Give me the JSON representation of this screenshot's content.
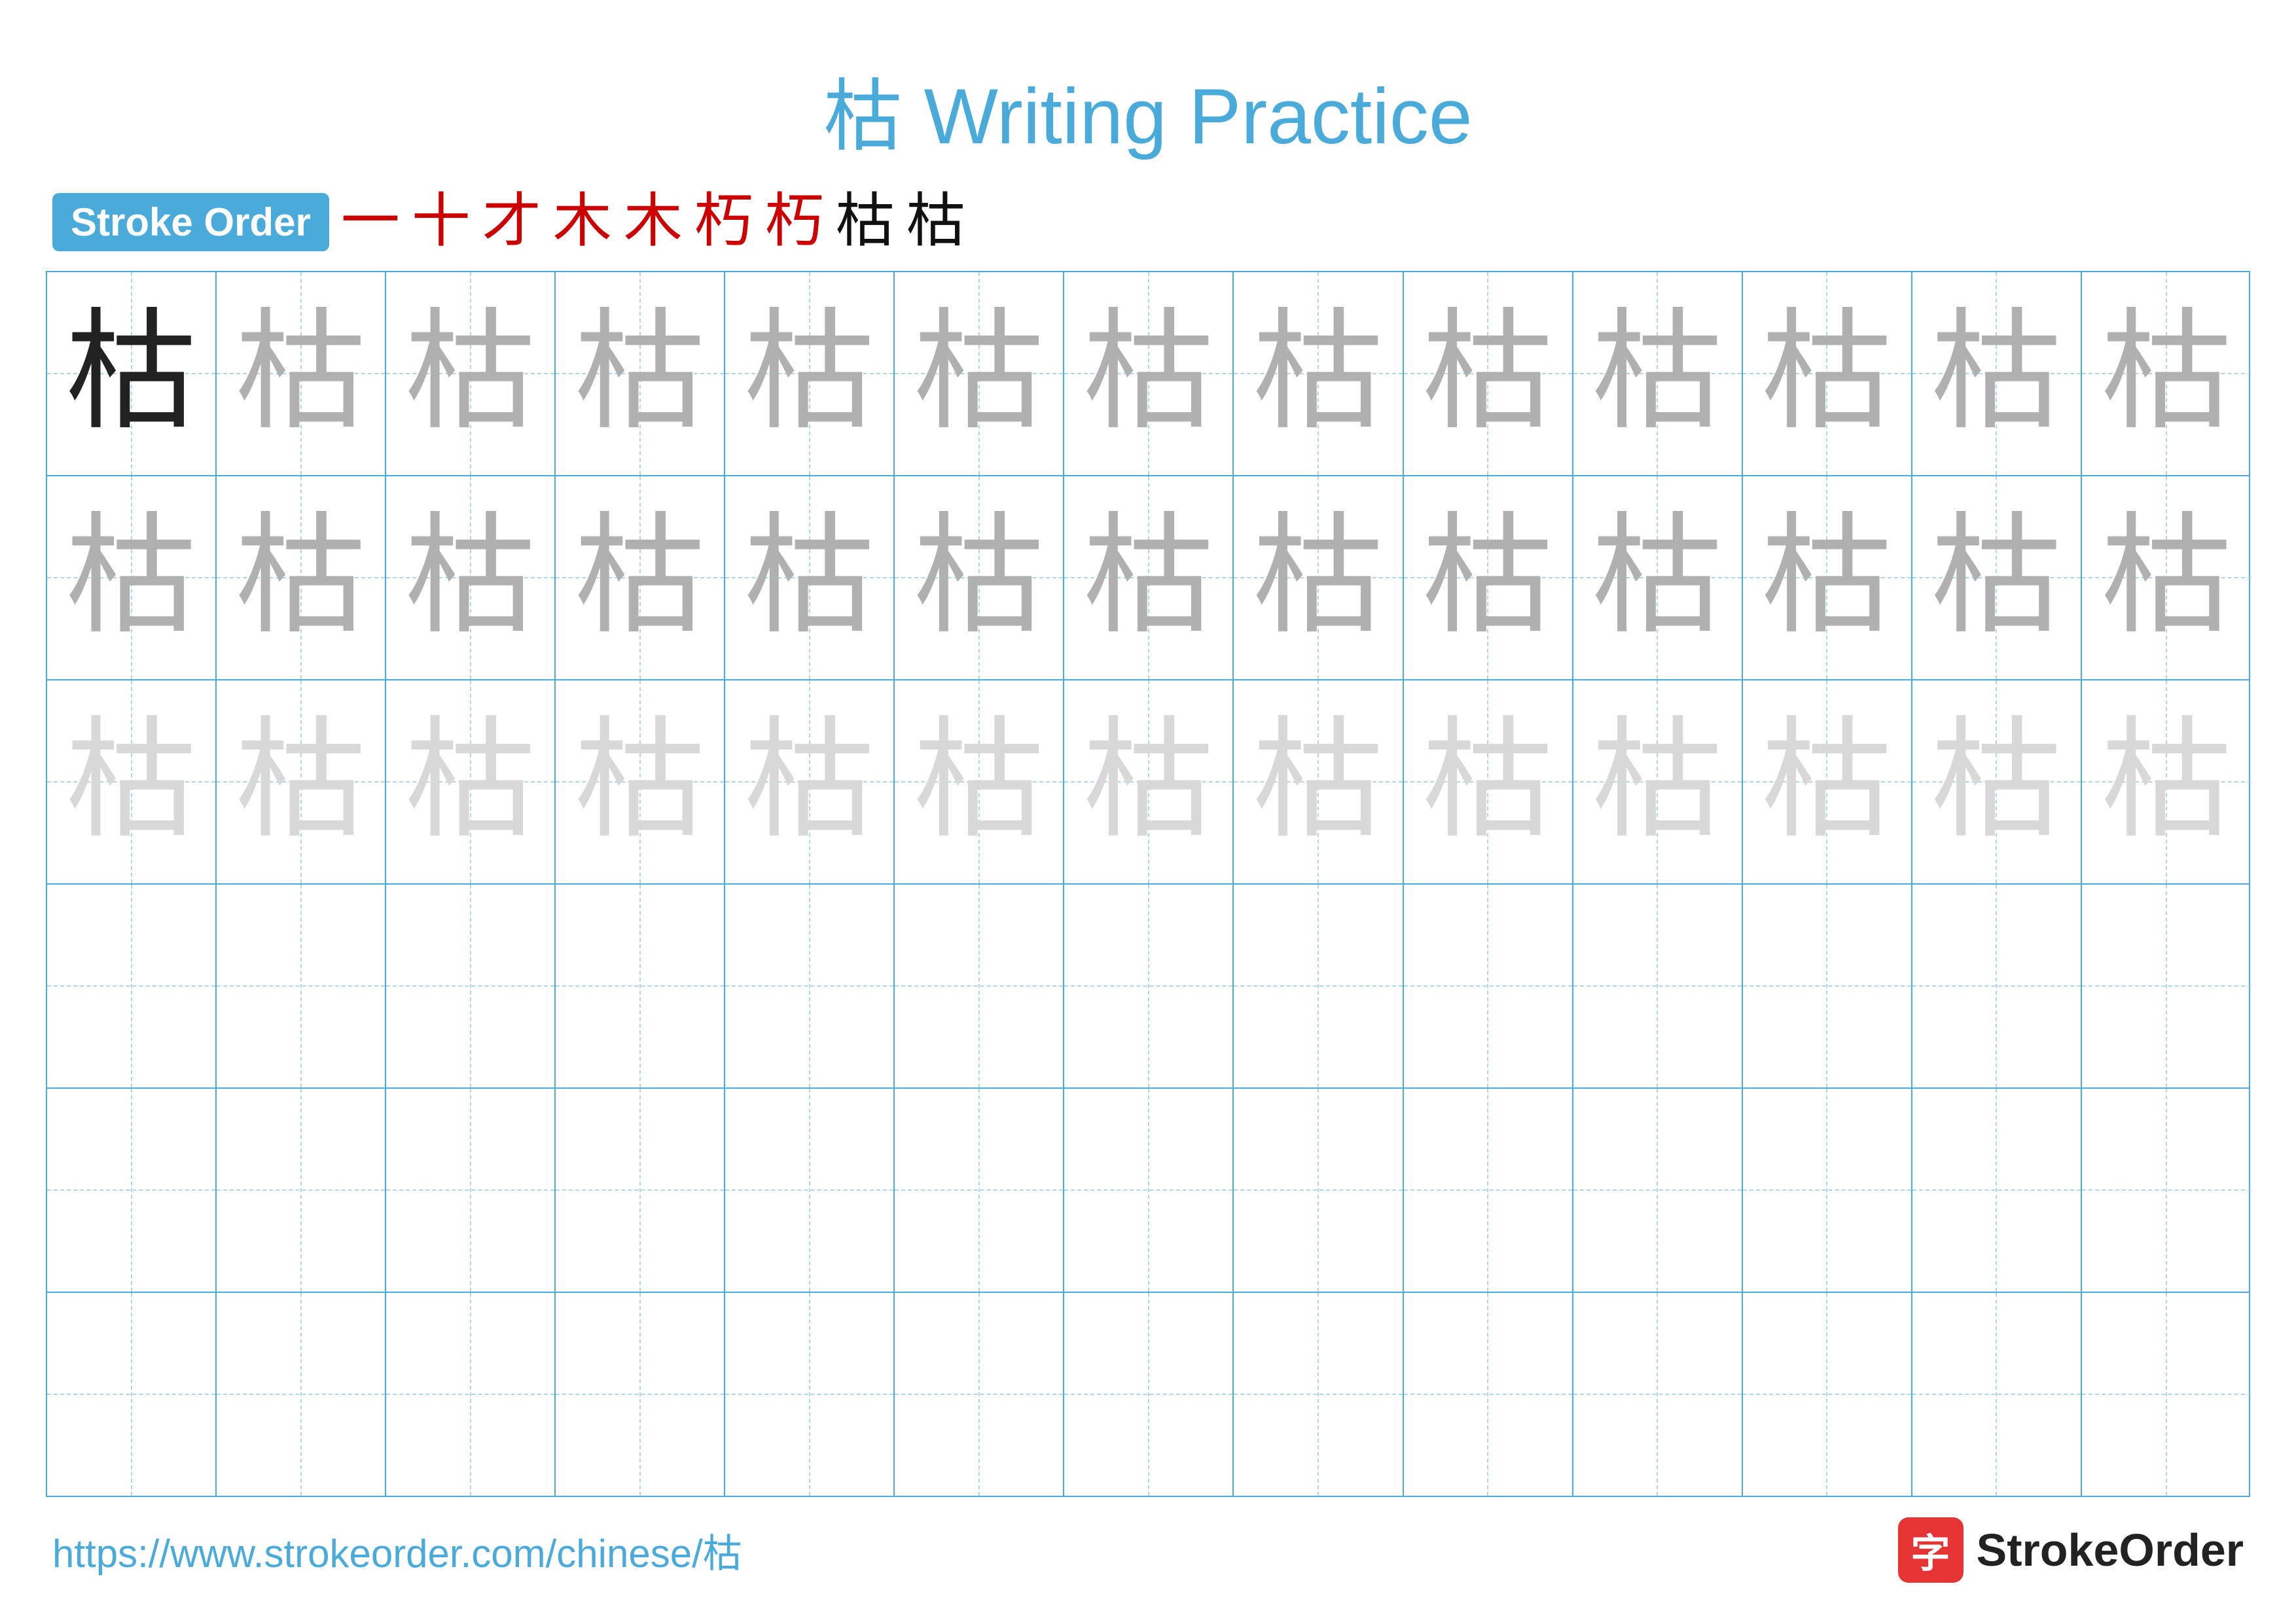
{
  "title": {
    "text": "枯 Writing Practice",
    "color": "#4AABDB"
  },
  "stroke_order": {
    "badge_label": "Stroke Order",
    "strokes": [
      "一",
      "十",
      "才",
      "木",
      "木",
      "朽",
      "朽",
      "枯",
      "枯"
    ]
  },
  "grid": {
    "rows": 6,
    "cols": 13,
    "char": "枯",
    "row_styles": [
      "solid_then_medium",
      "medium",
      "light",
      "empty",
      "empty",
      "empty"
    ]
  },
  "footer": {
    "url": "https://www.strokeorder.com/chinese/枯",
    "logo_char": "字",
    "logo_text": "StrokeOrder"
  }
}
